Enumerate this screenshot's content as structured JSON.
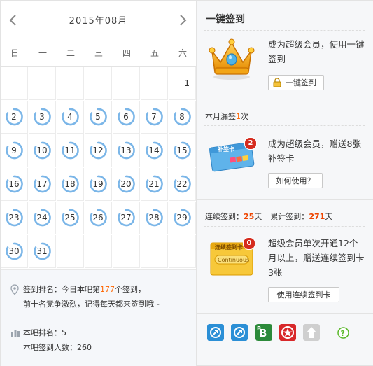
{
  "calendar": {
    "month_label": "2015年08月",
    "weekdays": [
      "日",
      "一",
      "二",
      "三",
      "四",
      "五",
      "六"
    ],
    "days": [
      "1",
      "2",
      "3",
      "4",
      "5",
      "6",
      "7",
      "8",
      "9",
      "10",
      "11",
      "12",
      "13",
      "14",
      "15",
      "16",
      "17",
      "18",
      "19",
      "20",
      "21",
      "22",
      "23",
      "24",
      "25",
      "26",
      "27",
      "28",
      "29",
      "30",
      "31"
    ],
    "first_weekday_index": 6
  },
  "ranking": {
    "prefix": "签到排名：今日本吧第",
    "rank": "177",
    "suffix": "个签到，",
    "line2": "前十名竞争激烈，记得每天都来签到哦~"
  },
  "bar_stats": {
    "rank_label": "本吧排名：5",
    "count_label": "本吧签到人数：260"
  },
  "one_click": {
    "title": "一键签到",
    "desc": "成为超级会员，使用一键签到",
    "button": "一键签到"
  },
  "missed": {
    "prefix": "本月漏签",
    "count": "1",
    "suffix": "次",
    "desc": "成为超级会员，赠送8张补签卡",
    "button": "如何使用？",
    "badge": "2",
    "card_text": "补签卡"
  },
  "streak": {
    "cont_label": "连续签到：",
    "cont_value": "25",
    "cont_unit": "天",
    "total_label": "累计签到：",
    "total_value": "271",
    "total_unit": "天",
    "desc": "超级会员单次开通12个月以上，赠送连续签到卡3张",
    "button": "使用连续签到卡",
    "badge": "0",
    "card_text": "连续签到卡",
    "card_sub": "Continuous"
  },
  "colors": {
    "accent_orange": "#ff6600",
    "ring_blue": "#7bb6e8",
    "button_border": "#c9c9c9"
  },
  "bottom_icons": [
    "sign-icon-1",
    "sign-icon-2",
    "bb-icon",
    "star-badge-icon",
    "up-arrow-icon",
    "help-icon"
  ]
}
